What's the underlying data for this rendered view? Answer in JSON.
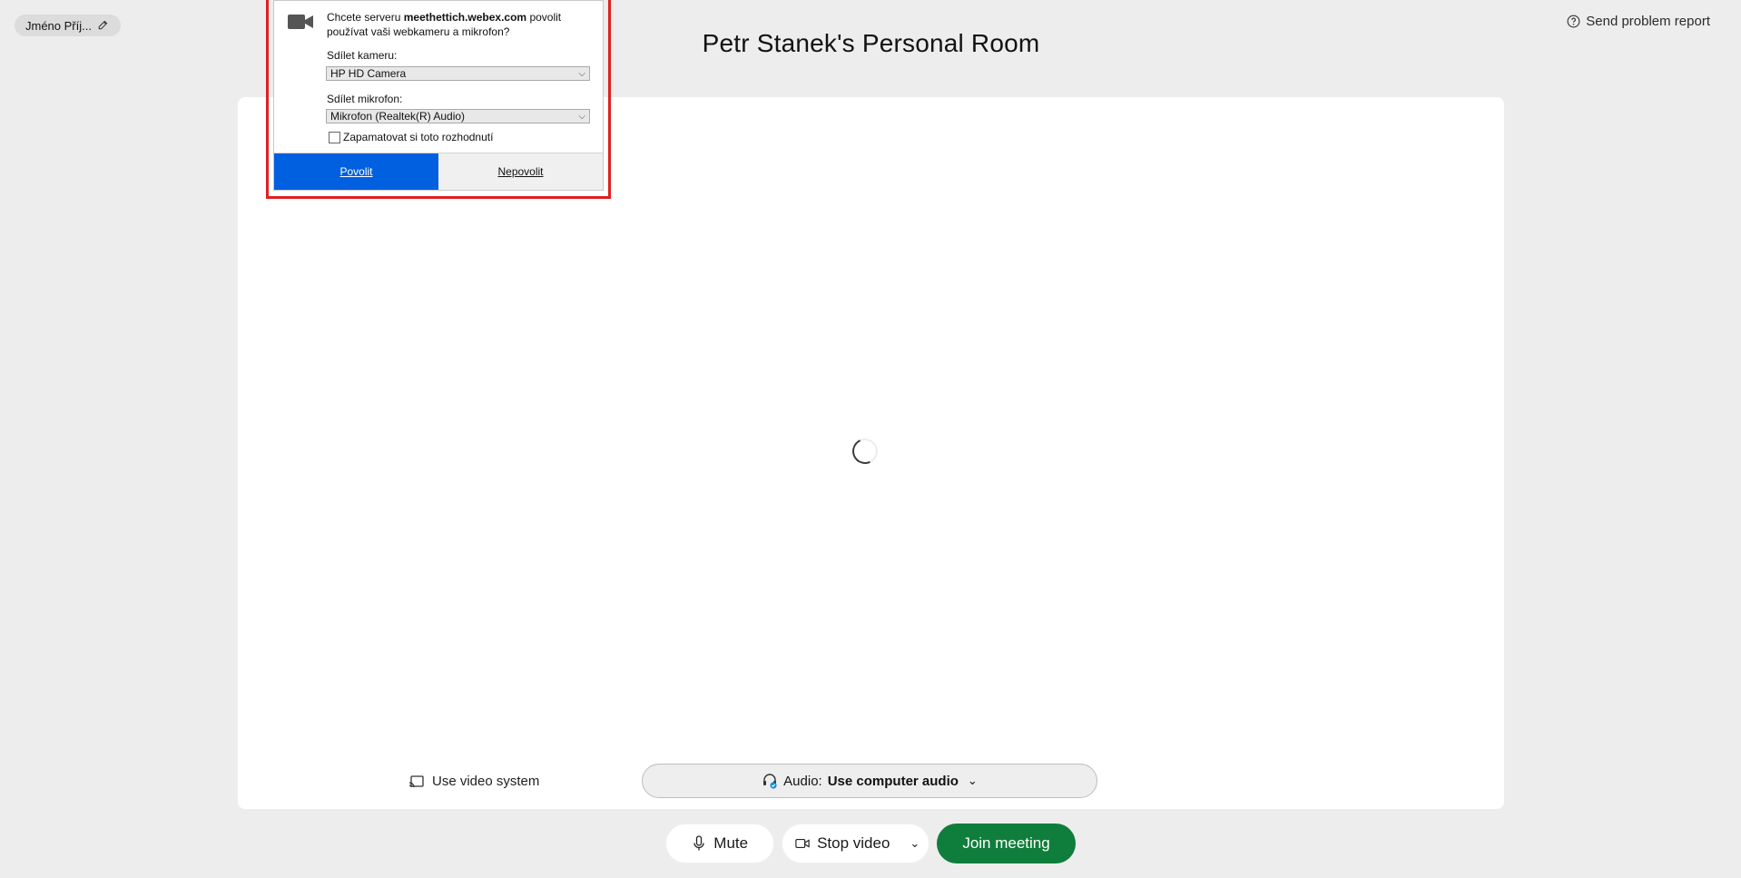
{
  "header": {
    "name_pill": "Jméno Příj...",
    "report_label": "Send problem report",
    "room_title": "Petr Stanek's Personal Room"
  },
  "stage": {
    "video_system_label": "Use video system",
    "audio_prefix": "Audio:",
    "audio_value": "Use computer audio"
  },
  "controls": {
    "mute_label": "Mute",
    "stop_video_label": "Stop video",
    "join_label": "Join meeting",
    "join_color": "#0f7d3b"
  },
  "permission_popup": {
    "question_prefix": "Chcete serveru",
    "server": "meethettich.webex.com",
    "question_suffix": "povolit používat vaši webkameru a mikrofon?",
    "camera_label": "Sdílet kameru:",
    "camera_value": "HP HD Camera",
    "mic_label": "Sdílet mikrofon:",
    "mic_value": "Mikrofon (Realtek(R) Audio)",
    "remember_label": "Zapamatovat si toto rozhodnutí",
    "allow_label": "Povolit",
    "deny_label": "Nepovolit",
    "allow_color": "#0060df",
    "highlight_color": "#e02020"
  },
  "icons": {
    "edit": "pencil-icon",
    "help": "question-circle-icon",
    "camera": "video-camera-icon",
    "cast": "cast-icon",
    "headset": "headset-icon",
    "mic": "microphone-icon",
    "video": "video-icon",
    "chevron": "chevron-down-icon"
  }
}
